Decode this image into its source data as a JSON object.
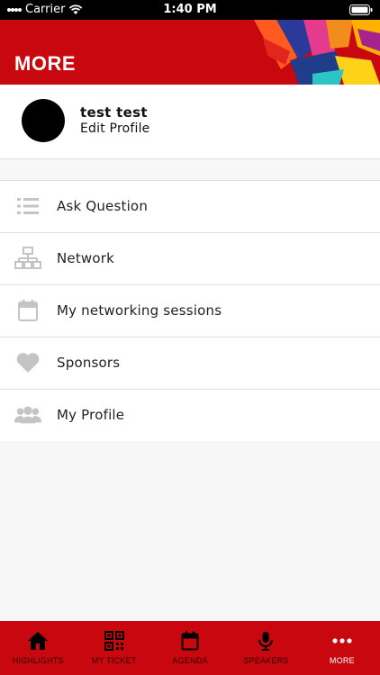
{
  "status_bar": {
    "carrier": "Carrier",
    "time": "1:40 PM"
  },
  "header": {
    "title": "MORE"
  },
  "profile": {
    "name": "test test",
    "edit_label": "Edit Profile"
  },
  "menu": {
    "items": [
      {
        "label": "Ask Question",
        "icon": "list-icon"
      },
      {
        "label": "Network",
        "icon": "network-icon"
      },
      {
        "label": "My networking sessions",
        "icon": "calendar-icon"
      },
      {
        "label": "Sponsors",
        "icon": "heart-icon"
      },
      {
        "label": "My Profile",
        "icon": "users-icon"
      }
    ]
  },
  "tab_bar": {
    "tabs": [
      {
        "label": "HIGHLIGHTS",
        "icon": "home-icon",
        "active": false
      },
      {
        "label": "MY TICKET",
        "icon": "qr-code-icon",
        "active": false
      },
      {
        "label": "AGENDA",
        "icon": "calendar-icon",
        "active": false
      },
      {
        "label": "SPEAKERS",
        "icon": "microphone-icon",
        "active": false
      },
      {
        "label": "MORE",
        "icon": "more-dots-icon",
        "active": true
      }
    ]
  },
  "colors": {
    "brand_red": "#c8070e",
    "icon_gray": "#c4c4c4",
    "active_tab_text": "#ffffff"
  }
}
